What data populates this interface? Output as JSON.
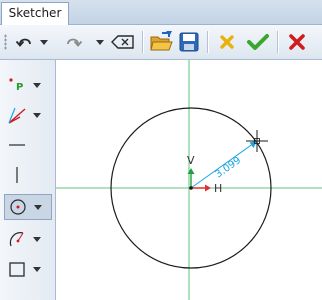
{
  "tab": {
    "label": "Sketcher"
  },
  "toolbar": {
    "buttons": [
      {
        "name": "undo-button",
        "icon": "undo-icon"
      },
      {
        "name": "redo-button",
        "icon": "redo-icon"
      },
      {
        "name": "delete-button",
        "icon": "backspace-icon"
      },
      {
        "name": "open-button",
        "icon": "folder-open-icon"
      },
      {
        "name": "save-button",
        "icon": "floppy-disk-icon"
      },
      {
        "name": "cancel-changes-button",
        "icon": "yellow-x-icon"
      },
      {
        "name": "accept-button",
        "icon": "green-check-icon"
      },
      {
        "name": "close-button",
        "icon": "red-x-icon"
      }
    ]
  },
  "side_tools": [
    {
      "name": "point-tool",
      "icon": "point-icon",
      "label": "P"
    },
    {
      "name": "angle-line-tool",
      "icon": "angled-lines-icon"
    },
    {
      "name": "horizontal-line-tool",
      "icon": "horizontal-line-icon"
    },
    {
      "name": "vertical-line-tool",
      "icon": "vertical-line-icon"
    },
    {
      "name": "circle-tool",
      "icon": "circle-icon",
      "active": true
    },
    {
      "name": "arc-tool",
      "icon": "arc-icon"
    },
    {
      "name": "rectangle-tool",
      "icon": "rectangle-icon"
    }
  ],
  "sketch": {
    "radius_label": "3.099",
    "axis_h_label": "H",
    "axis_v_label": "V"
  },
  "colors": {
    "axis_green": "#5cc47a",
    "dimension_cyan": "#1aa6e0",
    "h_arrow": "#e03030",
    "v_arrow": "#20a040"
  }
}
